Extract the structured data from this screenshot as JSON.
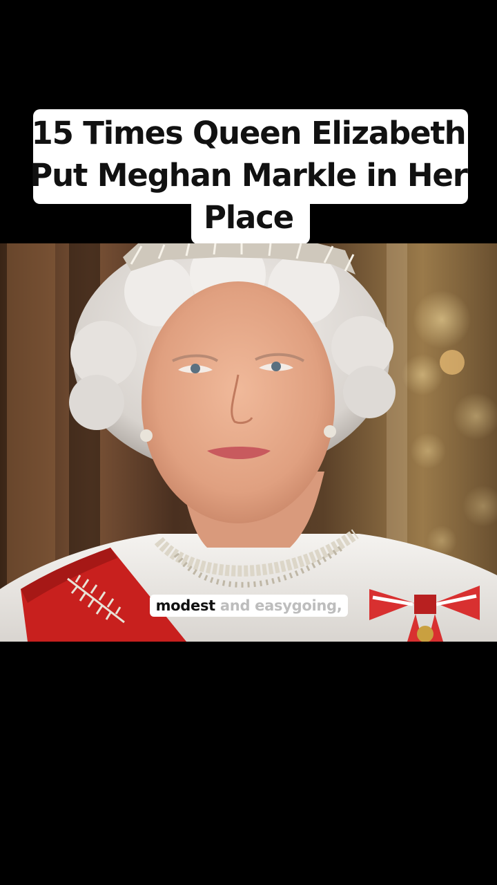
{
  "video": {
    "title": "15 Times Queen Elizabeth Put Meghan Markle in Her Place",
    "caption_active": "modest",
    "caption_rest": " and easygoing,"
  },
  "colors": {
    "background": "#000000",
    "caption_box": "#ffffff",
    "caption_active_text": "#111111",
    "caption_inactive_text": "#bdbdbd",
    "sash_red": "#c8201e"
  },
  "icons": {
    "frame_image": "portrait-of-queen-elizabeth"
  }
}
